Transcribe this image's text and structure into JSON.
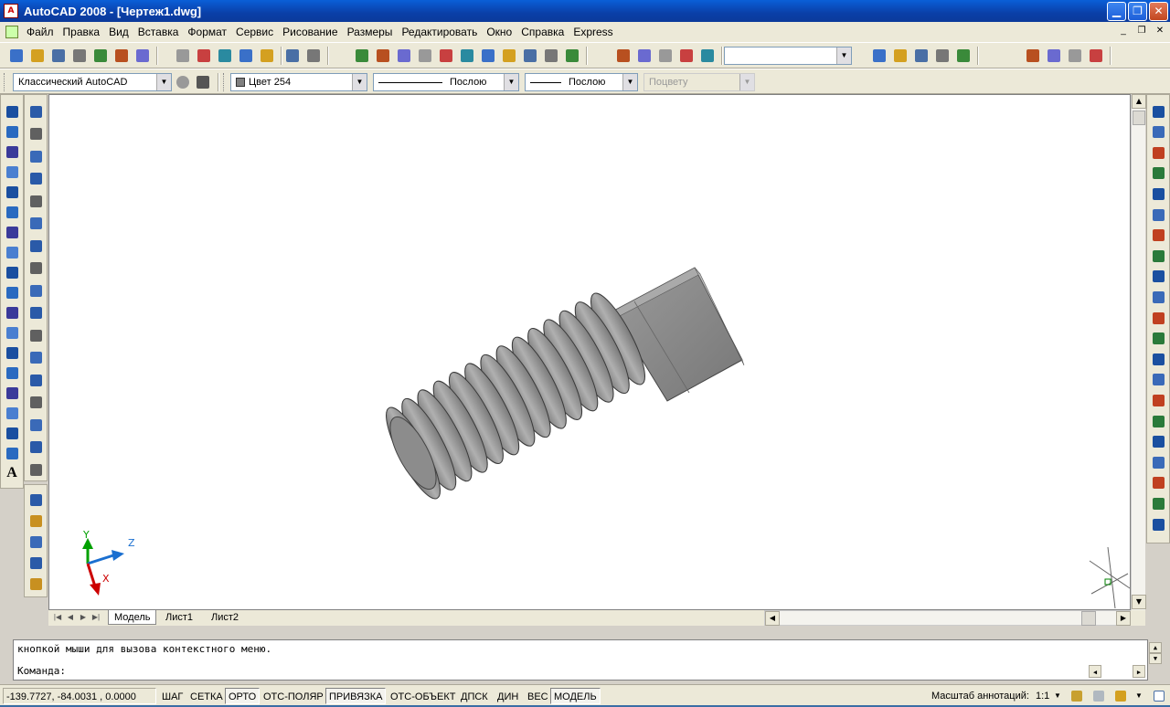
{
  "window": {
    "app_icon_label": "A",
    "title": "AutoCAD 2008 - [Чертеж1.dwg]",
    "min": "▁",
    "max": "❐",
    "close": "✕"
  },
  "menu": {
    "items": [
      "Файл",
      "Правка",
      "Вид",
      "Вставка",
      "Формат",
      "Сервис",
      "Рисование",
      "Размеры",
      "Редактировать",
      "Окно",
      "Справка",
      "Express"
    ],
    "mdi_min": "_",
    "mdi_restore": "❐",
    "mdi_close": "✕"
  },
  "toolbar2": {
    "workspace": "Классический AutoCAD",
    "color": "Цвет 254",
    "linetype": "Послою",
    "lineweight": "Послою",
    "plotstyle": "Поцвету",
    "arrow": "▼"
  },
  "tabs": {
    "model": "Модель",
    "layout1": "Лист1",
    "layout2": "Лист2"
  },
  "ucs": {
    "y": "Y",
    "z": "Z",
    "x": "X"
  },
  "command": {
    "history": "кнопкой мыши для вызова контекстного меню.",
    "prompt": "Команда:"
  },
  "status": {
    "coords": "-139.7727, -84.0031 , 0.0000",
    "buttons": [
      {
        "label": "ШАГ",
        "on": false
      },
      {
        "label": "СЕТКА",
        "on": false
      },
      {
        "label": "ОРТО",
        "on": true
      },
      {
        "label": "ОТС-ПОЛЯР",
        "on": false
      },
      {
        "label": "ПРИВЯЗКА",
        "on": true
      },
      {
        "label": "ОТС-ОБЪЕКТ",
        "on": false
      },
      {
        "label": "ДПСК",
        "on": false
      },
      {
        "label": "ДИН",
        "on": false
      },
      {
        "label": "ВЕС",
        "on": false
      },
      {
        "label": "МОДЕЛЬ",
        "on": true
      }
    ],
    "annotation_scale_label": "Масштаб аннотаций:",
    "annotation_scale": "1:1"
  },
  "colors": {
    "titlebar": "#0a3fa8",
    "drawing_bg": "#ffffff",
    "model_shade": "#8a8a8a",
    "ucs_x": "#cc0000",
    "ucs_y": "#00a000",
    "ucs_z": "#1a6fd0"
  },
  "icons": {
    "top_toolbar": [
      "new-icon",
      "open-icon",
      "save-icon",
      "plot-icon",
      "preview-icon",
      "publish-icon",
      "3d-dwf-icon",
      "cut-icon",
      "copy-icon",
      "paste-icon",
      "match-icon",
      "block-editor-icon",
      "undo-icon",
      "redo-icon",
      "pan-icon",
      "zoom-realtime-icon",
      "zoom-window-icon",
      "zoom-previous-icon",
      "properties-icon",
      "design-center-icon",
      "tool-palettes-icon",
      "sheet-set-icon",
      "markup-icon",
      "quickcalc-icon",
      "help-icon",
      "pan-3d-icon",
      "zoom-3d-icon",
      "orbit-icon",
      "walk-icon",
      "fly-icon",
      "ucs-icon",
      "box-icon",
      "wedge-icon",
      "sphere-icon",
      "render-icon",
      "materials-icon",
      "free-orbit-icon",
      "continuous-orbit-icon",
      "camera-icon"
    ],
    "left_draw": [
      "line-icon",
      "construction-line-icon",
      "polyline-icon",
      "polygon-icon",
      "rectangle-icon",
      "arc-icon",
      "circle-icon",
      "revision-cloud-icon",
      "spline-icon",
      "ellipse-icon",
      "ellipse-arc-icon",
      "insert-block-icon",
      "make-block-icon",
      "point-icon",
      "hatch-icon",
      "gradient-icon",
      "region-icon",
      "table-icon",
      "mtext-icon"
    ],
    "snap": [
      "snap-temp-icon",
      "snap-from-icon",
      "snap-endpoint-icon",
      "snap-midpoint-icon",
      "snap-intersection-icon",
      "snap-apparent-icon",
      "snap-extension-icon",
      "snap-center-icon",
      "snap-quadrant-icon",
      "snap-tangent-icon",
      "snap-perpendicular-icon",
      "snap-parallel-icon",
      "snap-insert-icon",
      "snap-node-icon",
      "snap-nearest-icon",
      "snap-none-icon",
      "snap-settings-icon"
    ],
    "dims": [
      "dim-linear-icon",
      "dim-aligned-icon",
      "dim-arc-icon",
      "dim-style-icon",
      "dim-update-icon"
    ],
    "modify": [
      "erase-icon",
      "copy-object-icon",
      "mirror-icon",
      "offset-icon",
      "array-icon",
      "move-icon",
      "rotate-icon",
      "scale-icon",
      "stretch-icon",
      "trim-icon",
      "extend-icon",
      "break-point-icon",
      "break-icon",
      "join-icon",
      "chamfer-icon",
      "fillet-icon",
      "explode-icon",
      "draworder-front-icon",
      "draworder-back-icon",
      "draworder-above-icon",
      "draworder-below-icon"
    ]
  }
}
